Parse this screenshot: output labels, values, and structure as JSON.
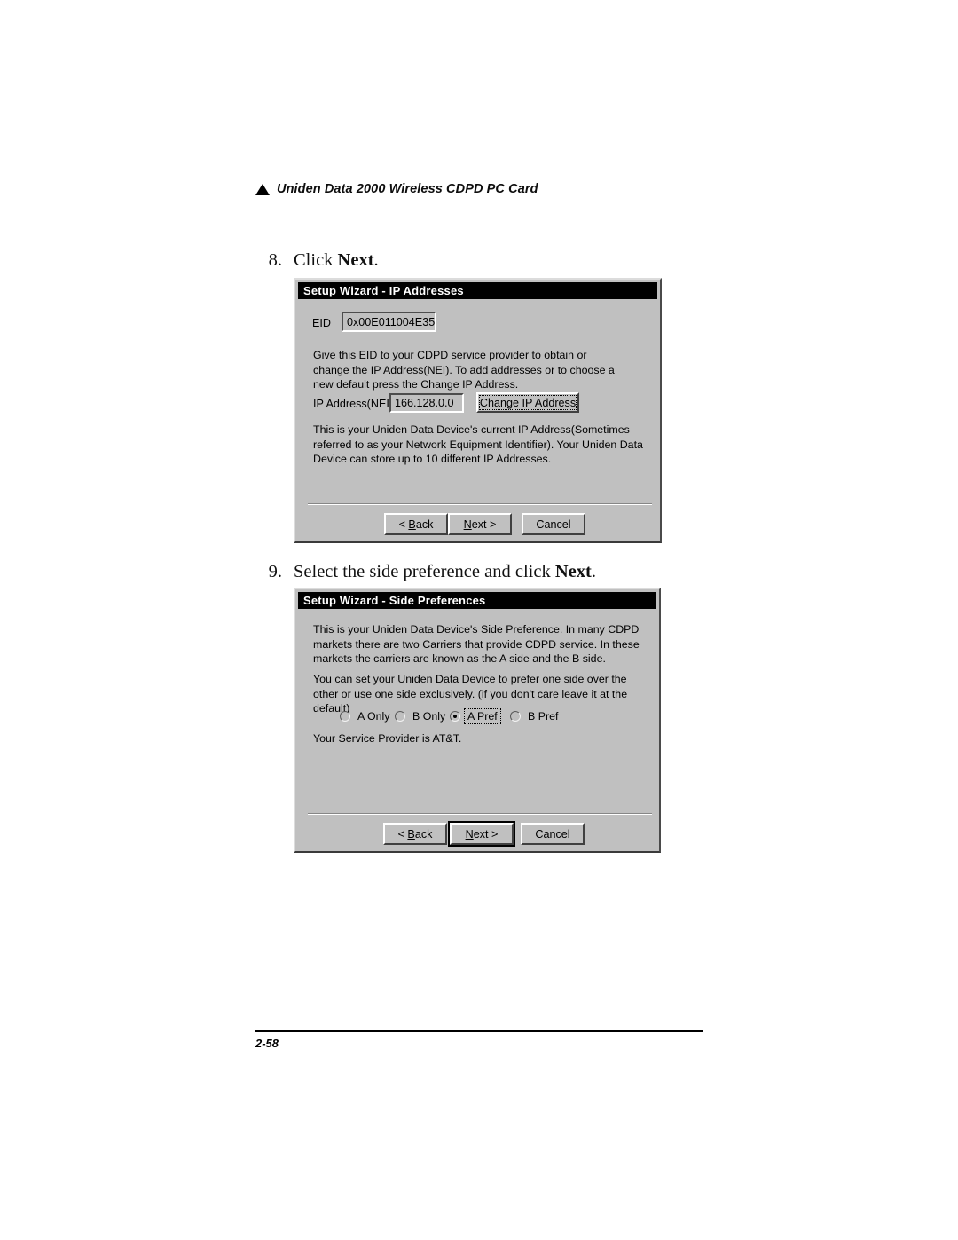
{
  "page": {
    "header_title": "Uniden Data 2000 Wireless CDPD PC Card",
    "header_bullet_icon": "triangle-bullet-icon",
    "page_number": "2-58"
  },
  "steps": [
    {
      "number": "8.",
      "text_before": "Click ",
      "text_bold": "Next",
      "text_after": "."
    },
    {
      "number": "9.",
      "text_before": "Select the side preference and click ",
      "text_bold": "Next",
      "text_after": "."
    }
  ],
  "dialog_ip": {
    "title": "Setup Wizard - IP Addresses",
    "eid_label": "EID",
    "eid_value": "0x00E011004E35",
    "paragraph1": "Give this EID to your CDPD service provider to obtain or\nchange the IP Address(NEI).  To add addresses or to choose a\nnew default press the Change IP Address.",
    "ip_label": "IP Address(NEI)",
    "ip_value": "166.128.0.0",
    "change_button": "Change IP Address",
    "paragraph2": "This is your Uniden Data Device's current IP Address(Sometimes\nreferred to as your Network Equipment Identifier).  Your Uniden Data\nDevice can store up to 10 different IP Addresses.",
    "buttons": {
      "back": "< Back",
      "next": "Next >",
      "cancel": "Cancel"
    }
  },
  "dialog_side": {
    "title": "Setup Wizard - Side Preferences",
    "paragraph1": "This is your Uniden Data Device's Side Preference.  In many CDPD\nmarkets there are two Carriers that provide CDPD service.  In these\nmarkets the carriers are known as the A side and the B side.",
    "paragraph2": "You can set your Uniden Data Device to prefer one side over the\nother or use one side exclusively. (if you don't care leave it at the\ndefault)",
    "radios": [
      {
        "label": "A Only",
        "checked": false,
        "focused": false
      },
      {
        "label": "B Only",
        "checked": false,
        "focused": false
      },
      {
        "label": "A Pref",
        "checked": true,
        "focused": true
      },
      {
        "label": "B Pref",
        "checked": false,
        "focused": false
      }
    ],
    "provider_text": "Your Service Provider is AT&T.",
    "buttons": {
      "back": "< Back",
      "next": "Next >",
      "cancel": "Cancel"
    }
  }
}
